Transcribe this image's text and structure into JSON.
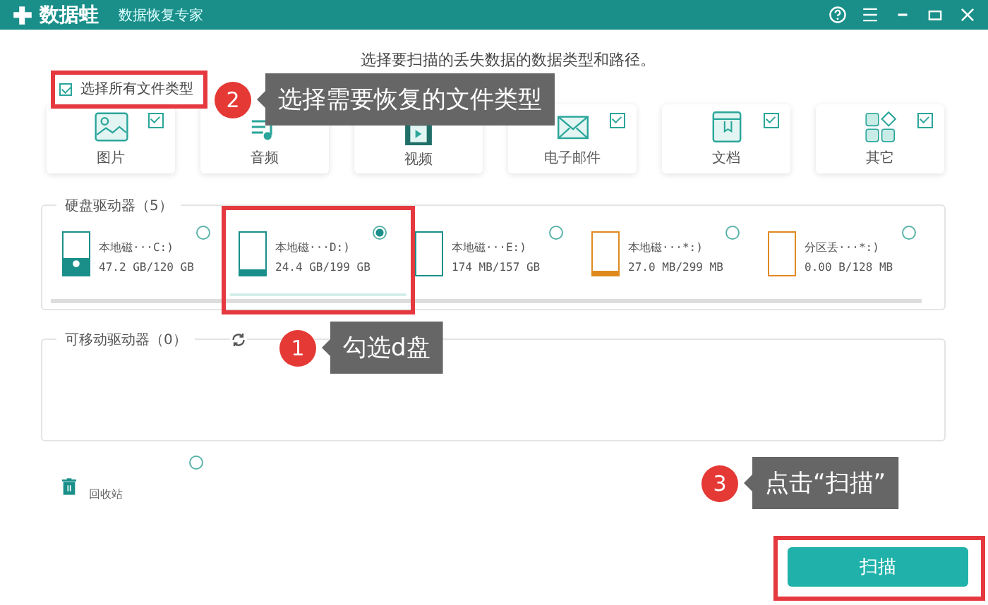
{
  "window": {
    "title": "数据蛙",
    "subtitle": "数据恢复专家"
  },
  "instruction": "选择要扫描的丢失数据的数据类型和路径。",
  "select_all": {
    "label": "选择所有文件类型",
    "checked": true
  },
  "file_types": [
    {
      "label": "图片",
      "kind": "image",
      "checked": true
    },
    {
      "label": "音频",
      "kind": "audio"
    },
    {
      "label": "视频",
      "kind": "video"
    },
    {
      "label": "电子邮件",
      "kind": "email",
      "checked": true
    },
    {
      "label": "文档",
      "kind": "document",
      "checked": true
    },
    {
      "label": "其它",
      "kind": "other",
      "checked": true
    }
  ],
  "hard_drives": {
    "title": "硬盘驱动器（5）",
    "items": [
      {
        "name": "本地磁···C:)",
        "usage": "47.2 GB/120 GB",
        "level": 0.39,
        "color": "#1a8f8a",
        "system": true,
        "selected": false
      },
      {
        "name": "本地磁···D:)",
        "usage": "24.4 GB/199 GB",
        "level": 0.12,
        "color": "#1a8f8a",
        "system": false,
        "selected": true
      },
      {
        "name": "本地磁···E:)",
        "usage": "174 MB/157 GB",
        "level": 0,
        "color": "#1a8f8a",
        "system": false,
        "selected": false
      },
      {
        "name": "本地磁···*:)",
        "usage": "27.0 MB/299 MB",
        "level": 0.09,
        "color": "#e08a1e",
        "system": false,
        "selected": false
      },
      {
        "name": "分区丢···*:)",
        "usage": "0.00  B/128 MB",
        "level": 0,
        "color": "#e08a1e",
        "system": false,
        "selected": false
      }
    ]
  },
  "removable_drives": {
    "title": "可移动驱动器（0）"
  },
  "recycle_bin": {
    "label": "回收站",
    "selected": false
  },
  "scan_button": "扫描",
  "callouts": [
    {
      "number": "2",
      "text": "选择需要恢复的文件类型"
    },
    {
      "number": "1",
      "text": "勾选d盘"
    },
    {
      "number": "3",
      "text": "点击“扫描”"
    }
  ]
}
